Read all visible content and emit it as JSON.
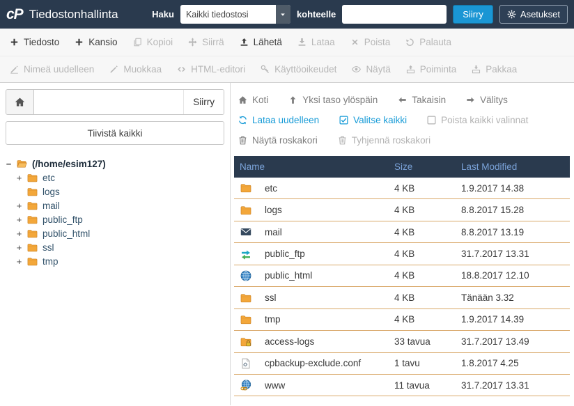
{
  "colors": {
    "header_bg": "#2a3a4e",
    "accent_blue": "#179bd7",
    "table_header_text": "#7aa2d8",
    "row_border": "#d9a768",
    "folder": "#f3a73a"
  },
  "header": {
    "logo": "cP",
    "title": "Tiedostonhallinta",
    "search_label": "Haku",
    "scope_select": {
      "value": "Kaikki tiedostosi",
      "icon": "caret-down"
    },
    "for_label": "kohteelle",
    "search_input": {
      "value": "",
      "placeholder": ""
    },
    "go_button": "Siirry",
    "settings_button": {
      "label": "Asetukset",
      "icon": "gear"
    }
  },
  "toolbar_row1": [
    {
      "label": "Tiedosto",
      "icon": "plus",
      "enabled": true
    },
    {
      "label": "Kansio",
      "icon": "plus",
      "enabled": true
    },
    {
      "label": "Kopioi",
      "icon": "copy",
      "enabled": false
    },
    {
      "label": "Siirrä",
      "icon": "move",
      "enabled": false
    },
    {
      "label": "Lähetä",
      "icon": "upload",
      "enabled": true
    },
    {
      "label": "Lataa",
      "icon": "download",
      "enabled": false
    },
    {
      "label": "Poista",
      "icon": "delete",
      "enabled": false
    },
    {
      "label": "Palauta",
      "icon": "restore",
      "enabled": false
    }
  ],
  "toolbar_row2": [
    {
      "label": "Nimeä uudelleen",
      "icon": "rename",
      "enabled": false
    },
    {
      "label": "Muokkaa",
      "icon": "edit",
      "enabled": false
    },
    {
      "label": "HTML-editori",
      "icon": "code",
      "enabled": false
    },
    {
      "label": "Käyttöoikeudet",
      "icon": "key",
      "enabled": false
    },
    {
      "label": "Näytä",
      "icon": "eye",
      "enabled": false
    },
    {
      "label": "Poiminta",
      "icon": "extract",
      "enabled": false
    },
    {
      "label": "Pakkaa",
      "icon": "compress",
      "enabled": false
    }
  ],
  "sidebar": {
    "home_icon": "home",
    "search_input": {
      "value": "",
      "placeholder": ""
    },
    "go_button": "Siirry",
    "collapse_button": "Tiivistä kaikki",
    "tree_root": {
      "toggle": "−",
      "icon": "folder-open",
      "label": "(/home/esim127)"
    },
    "tree": [
      {
        "toggle": "+",
        "icon": "folder",
        "label": "etc"
      },
      {
        "toggle": "",
        "icon": "folder",
        "label": "logs"
      },
      {
        "toggle": "+",
        "icon": "folder",
        "label": "mail"
      },
      {
        "toggle": "+",
        "icon": "folder",
        "label": "public_ftp"
      },
      {
        "toggle": "+",
        "icon": "folder",
        "label": "public_html"
      },
      {
        "toggle": "+",
        "icon": "folder",
        "label": "ssl"
      },
      {
        "toggle": "+",
        "icon": "folder",
        "label": "tmp"
      }
    ]
  },
  "filenav": {
    "row1": [
      {
        "label": "Koti",
        "icon": "home",
        "state": "muted"
      },
      {
        "label": "Yksi taso ylöspäin",
        "icon": "arrow-up",
        "state": "muted"
      },
      {
        "label": "Takaisin",
        "icon": "arrow-left",
        "state": "muted"
      },
      {
        "label": "Välitys",
        "icon": "arrow-right",
        "state": "muted"
      }
    ],
    "row2": [
      {
        "label": "Lataa uudelleen",
        "icon": "reload",
        "state": "link"
      },
      {
        "label": "Valitse kaikki",
        "icon": "check-square",
        "state": "link"
      },
      {
        "label": "Poista kaikki valinnat",
        "icon": "square",
        "state": "disabled"
      }
    ],
    "row3": [
      {
        "label": "Näytä roskakori",
        "icon": "trash",
        "state": "muted"
      },
      {
        "label": "Tyhjennä roskakori",
        "icon": "trash",
        "state": "disabled"
      }
    ]
  },
  "table": {
    "headers": {
      "name": "Name",
      "size": "Size",
      "modified": "Last Modified"
    },
    "rows": [
      {
        "icon": "folder",
        "name": "etc",
        "size": "4 KB",
        "modified": "1.9.2017 14.38"
      },
      {
        "icon": "folder",
        "name": "logs",
        "size": "4 KB",
        "modified": "8.8.2017 15.28"
      },
      {
        "icon": "mail",
        "name": "mail",
        "size": "4 KB",
        "modified": "8.8.2017 13.19"
      },
      {
        "icon": "transfer",
        "name": "public_ftp",
        "size": "4 KB",
        "modified": "31.7.2017 13.31"
      },
      {
        "icon": "globe",
        "name": "public_html",
        "size": "4 KB",
        "modified": "18.8.2017 12.10"
      },
      {
        "icon": "folder",
        "name": "ssl",
        "size": "4 KB",
        "modified": "Tänään 3.32"
      },
      {
        "icon": "folder",
        "name": "tmp",
        "size": "4 KB",
        "modified": "1.9.2017 14.39"
      },
      {
        "icon": "folder-lock",
        "name": "access-logs",
        "size": "33 tavua",
        "modified": "31.7.2017 13.49"
      },
      {
        "icon": "file-config",
        "name": "cpbackup-exclude.conf",
        "size": "1 tavu",
        "modified": "1.8.2017 4.25"
      },
      {
        "icon": "globe-link",
        "name": "www",
        "size": "11 tavua",
        "modified": "31.7.2017 13.31"
      }
    ]
  }
}
